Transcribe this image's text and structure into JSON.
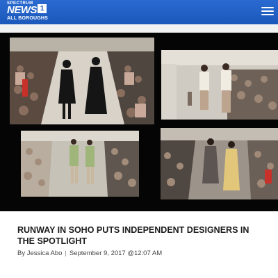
{
  "header": {
    "brand_top": "SPECTRUM",
    "brand_name": "NEWS",
    "brand_channel": "1",
    "region": "ALL BOROUGHS",
    "menu_icon": "hamburger-menu-icon",
    "background_color": "#1c58bb"
  },
  "article": {
    "image_description": "Four runway photos of models walking in front of an audience",
    "headline": "RUNWAY IN SOHO PUTS INDEPENDENT DESIGNERS IN THE SPOTLIGHT",
    "author": "By Jessica Abo",
    "separator": "|",
    "date": "September 9, 2017 @12:07 AM"
  }
}
